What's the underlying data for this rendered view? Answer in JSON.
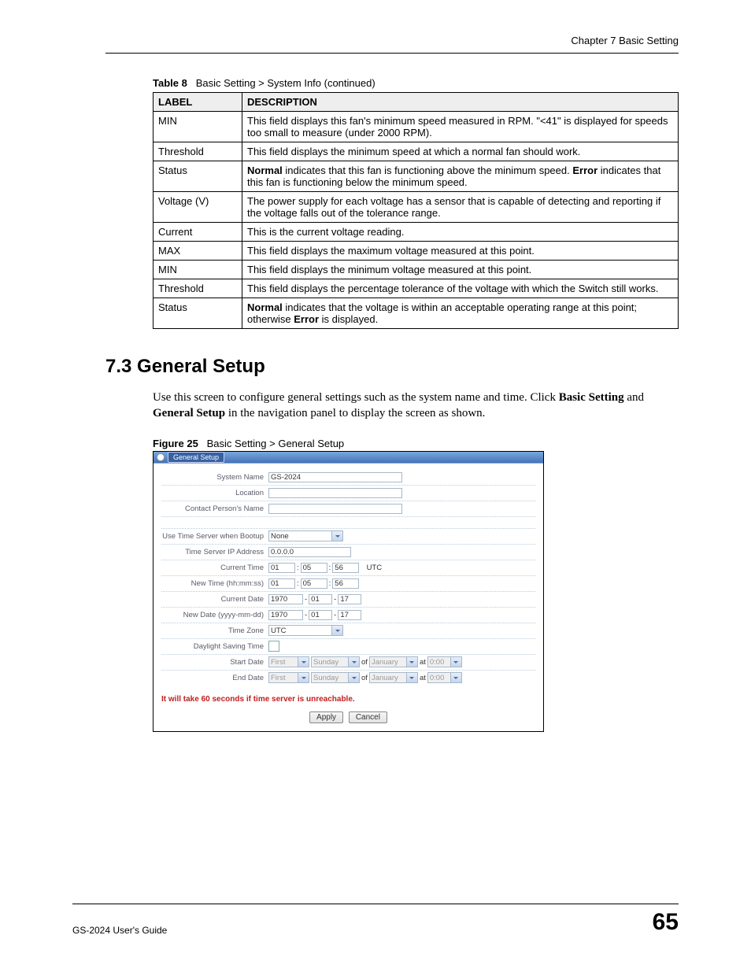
{
  "chapter_header": "Chapter 7 Basic Setting",
  "table_caption_prefix": "Table 8",
  "table_caption_text": "Basic Setting > System Info  (continued)",
  "table_headers": {
    "label": "LABEL",
    "desc": "DESCRIPTION"
  },
  "rows": [
    {
      "label": "MIN",
      "desc_parts": [
        "This field displays this fan's minimum speed measured in RPM. \"<41\" is displayed for speeds too small to measure (under 2000 RPM)."
      ]
    },
    {
      "label": "Threshold",
      "desc_parts": [
        "This field displays the minimum speed at which a normal fan should work."
      ]
    },
    {
      "label": "Status",
      "desc_parts": [
        {
          "b": "Normal"
        },
        " indicates that this fan is functioning above the minimum speed. ",
        {
          "b": "Error"
        },
        " indicates that this fan is functioning below the minimum speed."
      ]
    },
    {
      "label": "Voltage (V)",
      "desc_parts": [
        "The power supply for each voltage has a sensor that is capable of detecting and reporting if the voltage falls out of the tolerance range."
      ]
    },
    {
      "label": "Current",
      "desc_parts": [
        "This is the current voltage reading."
      ]
    },
    {
      "label": "MAX",
      "desc_parts": [
        "This field displays the maximum voltage measured at this point."
      ]
    },
    {
      "label": "MIN",
      "desc_parts": [
        "This field displays the minimum voltage measured at this point."
      ]
    },
    {
      "label": "Threshold",
      "desc_parts": [
        "This field displays the percentage tolerance of the voltage with which the Switch still works."
      ]
    },
    {
      "label": "Status",
      "desc_parts": [
        {
          "b": "Normal"
        },
        " indicates that the voltage is within an acceptable operating range at this point; otherwise ",
        {
          "b": "Error"
        },
        " is displayed."
      ]
    }
  ],
  "section_title": "7.3  General Setup",
  "body_text_html": "Use this screen to configure general settings such as the system name and time. Click <b>Basic Setting</b> and <b>General Setup</b> in the navigation panel to display the screen as shown.",
  "figure_caption_prefix": "Figure 25",
  "figure_caption_text": "Basic Setting > General Setup",
  "figure": {
    "titlebar": "General Setup",
    "system_name": {
      "label": "System Name",
      "value": "GS-2024"
    },
    "location": {
      "label": "Location",
      "value": ""
    },
    "contact": {
      "label": "Contact Person's Name",
      "value": ""
    },
    "use_time_server": {
      "label": "Use Time Server when Bootup",
      "value": "None"
    },
    "time_server_ip": {
      "label": "Time Server IP Address",
      "value": "0.0.0.0"
    },
    "current_time": {
      "label": "Current Time",
      "h": "01",
      "m": "05",
      "s": "56",
      "suffix": "UTC"
    },
    "new_time": {
      "label": "New Time (hh:mm:ss)",
      "h": "01",
      "m": "05",
      "s": "56"
    },
    "current_date": {
      "label": "Current Date",
      "y": "1970",
      "mo": "01",
      "d": "17"
    },
    "new_date": {
      "label": "New Date (yyyy-mm-dd)",
      "y": "1970",
      "mo": "01",
      "d": "17"
    },
    "time_zone": {
      "label": "Time Zone",
      "value": "UTC"
    },
    "dst": {
      "label": "Daylight Saving Time"
    },
    "start_date": {
      "label": "Start Date",
      "ord": "First",
      "day": "Sunday",
      "of": "of",
      "month": "January",
      "at": "at",
      "time": "0:00"
    },
    "end_date": {
      "label": "End Date",
      "ord": "First",
      "day": "Sunday",
      "of": "of",
      "month": "January",
      "at": "at",
      "time": "0:00"
    },
    "warning": "It will take 60 seconds if time server is unreachable.",
    "apply": "Apply",
    "cancel": "Cancel"
  },
  "footer": {
    "guide": "GS-2024 User's Guide",
    "page": "65"
  }
}
